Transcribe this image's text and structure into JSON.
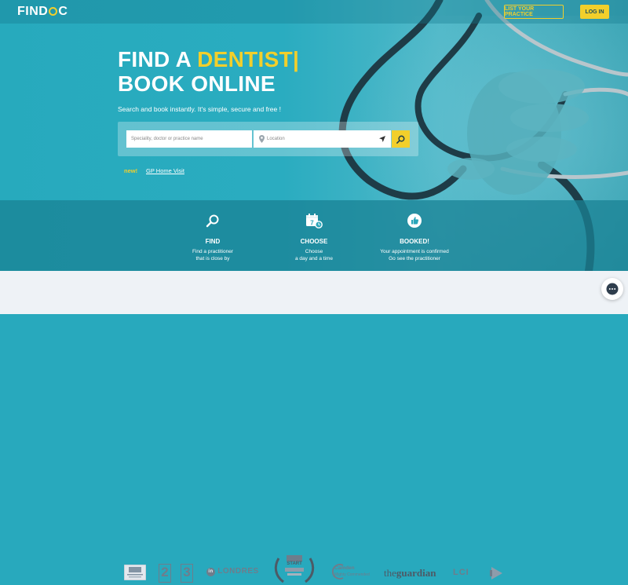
{
  "header": {
    "logo": {
      "left": "FIND",
      "right": "C"
    },
    "list_practice_label": "LIST YOUR PRACTICE",
    "login_label": "LOG IN"
  },
  "hero": {
    "headline_prefix": "FIND A ",
    "headline_accent": "DENTIST|",
    "headline_line2": "BOOK ONLINE",
    "subline": "Search and book instantly. It's simple, secure and free !",
    "search": {
      "speciality_placeholder": "Speciality, doctor or practice name",
      "location_placeholder": "Location"
    },
    "new_label": "new!",
    "gp_link": "GP Home Visit"
  },
  "steps": [
    {
      "title": "FIND",
      "line1": "Find a practitioner",
      "line2": "that is close by"
    },
    {
      "title": "CHOOSE",
      "line1": "Choose",
      "line2": "a day and a time",
      "calendar_digit": "7"
    },
    {
      "title": "BOOKED!",
      "line1": "Your appointment is confirmed",
      "line2": "Go see the practitioner"
    }
  ],
  "press": {
    "france2": "2",
    "france3": "3",
    "londres": "LONDRES",
    "londres_prefix": "in",
    "award_top": "START",
    "camden": "Camden",
    "camden_sub": "Mighty Commended",
    "guardian_pre": "the",
    "guardian_main": "guardian",
    "lci": "LCI"
  },
  "colors": {
    "accent": "#f2cf2b",
    "hero_bg": "#28a9bd",
    "logo_strip_bg": "#eef2f6"
  }
}
